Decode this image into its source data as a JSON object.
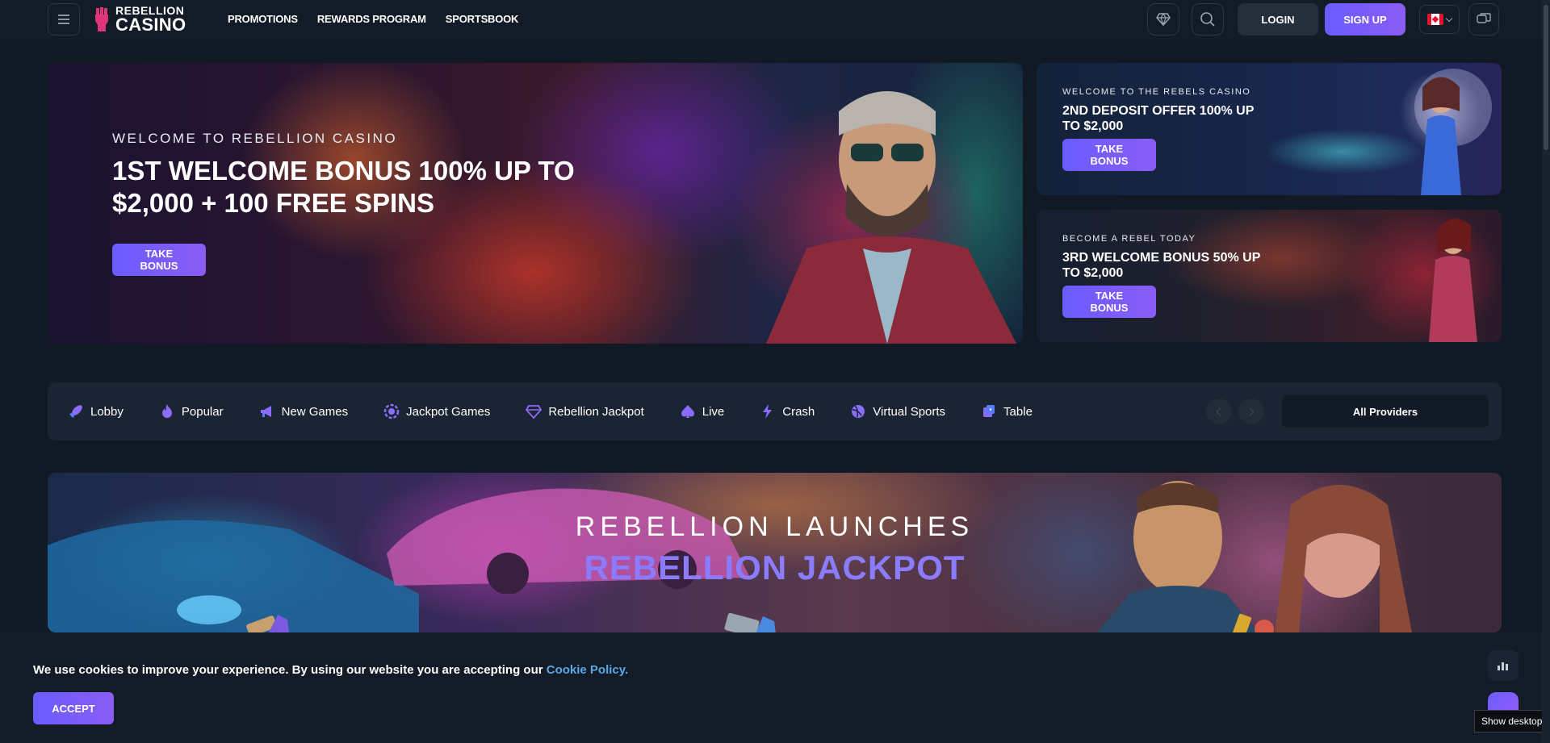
{
  "header": {
    "logo_top": "REBELLION",
    "logo_bottom": "CASINO",
    "nav": [
      "PROMOTIONS",
      "REWARDS PROGRAM",
      "SPORTSBOOK"
    ],
    "login_label": "LOGIN",
    "signup_label": "SIGN UP",
    "icons": [
      "menu-icon",
      "diamond-icon",
      "search-icon",
      "flag-canada-icon",
      "chat-icon"
    ]
  },
  "hero": {
    "kicker": "WELCOME TO REBELLION CASINO",
    "title": "1ST WELCOME BONUS 100% UP TO $2,000 + 100 FREE SPINS",
    "button_label": "TAKE BONUS"
  },
  "side_cards": [
    {
      "kicker": "WELCOME TO THE REBELS CASINO",
      "title": "2ND DEPOSIT OFFER 100% UP TO $2,000",
      "button_label": "TAKE BONUS"
    },
    {
      "kicker": "BECOME A REBEL TODAY",
      "title": "3RD WELCOME BONUS 50% UP TO $2,000",
      "button_label": "TAKE BONUS"
    }
  ],
  "categories": [
    {
      "label": "Lobby",
      "icon": "rocket-icon"
    },
    {
      "label": "Popular",
      "icon": "flame-icon"
    },
    {
      "label": "New Games",
      "icon": "megaphone-icon"
    },
    {
      "label": "Jackpot Games",
      "icon": "chip-icon"
    },
    {
      "label": "Rebellion Jackpot",
      "icon": "gem-icon"
    },
    {
      "label": "Live",
      "icon": "spade-icon"
    },
    {
      "label": "Crash",
      "icon": "lightning-icon"
    },
    {
      "label": "Virtual Sports",
      "icon": "ball-icon"
    },
    {
      "label": "Table",
      "icon": "dice-icon"
    }
  ],
  "providers_label": "All Providers",
  "promo": {
    "line1": "REBELLION LAUNCHES",
    "line2": "REBELLION JACKPOT"
  },
  "cookie": {
    "text": "We use cookies to improve your experience. By using our website you are accepting our",
    "link": "Cookie Policy.",
    "accept_label": "ACCEPT"
  },
  "tooltip": "Show desktop",
  "colors": {
    "background": "#111a24",
    "accent": "#6a5cff",
    "link": "#5aa8e6",
    "promo_highlight": "#8b7bff"
  }
}
